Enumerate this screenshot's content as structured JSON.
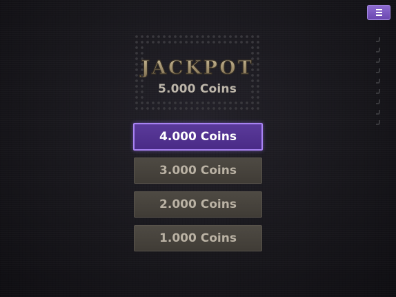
{
  "jackpot": {
    "title": "JACKPOT",
    "value": "5.000 Coins"
  },
  "prizes": [
    {
      "label": "4.000 Coins",
      "selected": true
    },
    {
      "label": "3.000 Coins",
      "selected": false
    },
    {
      "label": "2.000 Coins",
      "selected": false
    },
    {
      "label": "1.000 Coins",
      "selected": false
    }
  ],
  "menu": {
    "icon": "hamburger-menu-icon",
    "color": "#7a58c0"
  },
  "colors": {
    "selected_fill": "#4f2f90",
    "selected_border": "#a883f2",
    "button_fill": "#48443d",
    "button_text": "#bab2a4",
    "jackpot_text": "#a89a7e"
  }
}
